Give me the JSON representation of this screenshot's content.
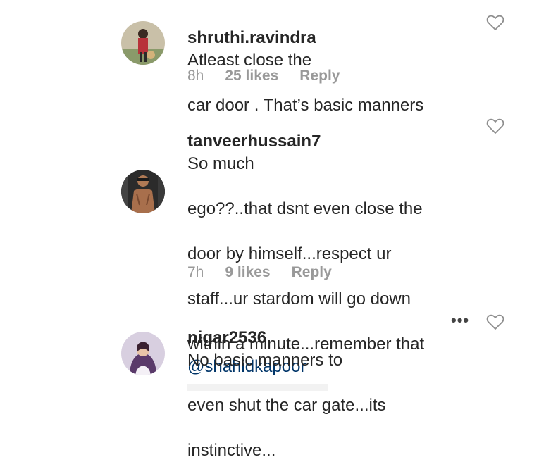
{
  "comments": [
    {
      "username": "shruthi.ravindra",
      "text_line1": "Atleast close the",
      "text_line2": "car door . That’s basic manners",
      "time": "8h",
      "likes": "25 likes",
      "reply": "Reply",
      "avatar_icon": "user-avatar-photo",
      "like_icon": "heart-outline-icon"
    },
    {
      "username": "tanveerhussain7",
      "text_line1": "So much",
      "text_line2": "ego??..that dsnt even close the",
      "text_line3": "door by himself...respect ur",
      "text_line4": "staff...ur stardom will go down",
      "text_line5": "within a minute...remember that",
      "mention": "@shahidkapoor",
      "time": "7h",
      "likes": "9 likes",
      "reply": "Reply",
      "avatar_icon": "user-avatar-photo",
      "like_icon": "heart-outline-icon"
    },
    {
      "username": "nigar2536",
      "text_line1": "No basic manners to",
      "text_line2": "even shut the car gate...its",
      "text_line3": "instinctive...",
      "more": "•••",
      "avatar_icon": "user-avatar-photo",
      "like_icon": "heart-outline-icon"
    }
  ],
  "colors": {
    "text": "#262626",
    "meta": "#999999",
    "mention": "#003569"
  }
}
